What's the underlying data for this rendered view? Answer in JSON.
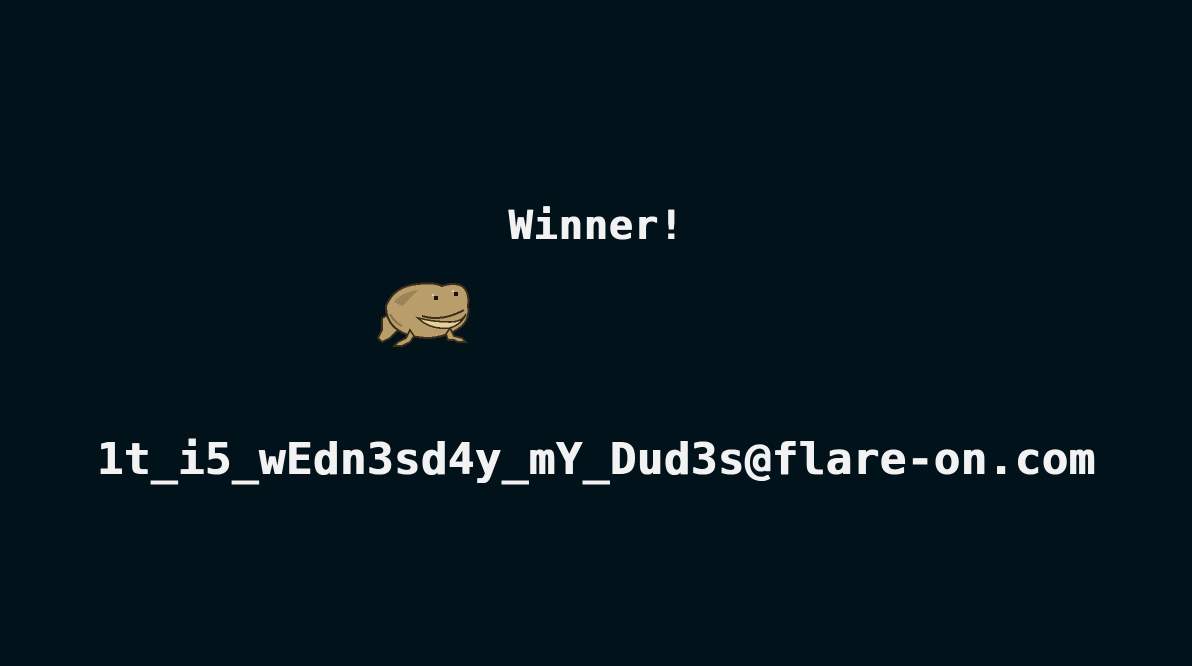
{
  "game": {
    "title": "Winner!",
    "flag": "1t_i5_wEdn3sd4y_mY_Dud3s@flare-on.com",
    "sprite": "frog-sprite"
  },
  "colors": {
    "background": "#02121b",
    "text": "#f2f2f2",
    "frog_body": "#b99e6c",
    "frog_belly": "#e6cf98",
    "frog_outline": "#3b2f1c"
  }
}
